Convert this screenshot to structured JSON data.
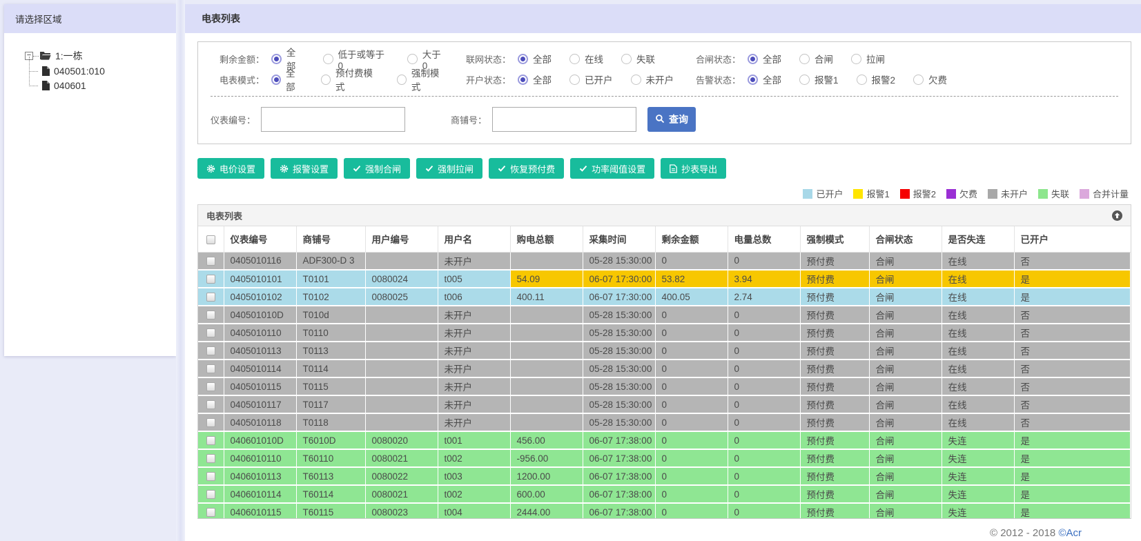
{
  "sidebar": {
    "title": "请选择区域",
    "tree": {
      "root_label": "1:一栋",
      "expander": "−",
      "children": [
        "040501:010",
        "040601"
      ]
    }
  },
  "main": {
    "title": "电表列表",
    "filters": [
      {
        "label": "剩余金额：",
        "options": [
          "全部",
          "低于或等于0",
          "大于0"
        ],
        "selected": 0
      },
      {
        "label": "联网状态：",
        "options": [
          "全部",
          "在线",
          "失联"
        ],
        "selected": 0
      },
      {
        "label": "合闸状态：",
        "options": [
          "全部",
          "合闸",
          "拉闸"
        ],
        "selected": 0
      },
      {
        "label": "电表模式：",
        "options": [
          "全部",
          "预付费模式",
          "强制模式"
        ],
        "selected": 0
      },
      {
        "label": "开户状态：",
        "options": [
          "全部",
          "已开户",
          "未开户"
        ],
        "selected": 0
      },
      {
        "label": "告警状态：",
        "options": [
          "全部",
          "报警1",
          "报警2",
          "欠费"
        ],
        "selected": 0
      }
    ],
    "search": {
      "meter_label": "仪表编号：",
      "meter_value": "",
      "meter_placeholder": "",
      "shop_label": "商铺号：",
      "shop_value": "",
      "shop_placeholder": "",
      "query_label": "查询",
      "query_icon": "search-icon",
      "query_color": "#4a74c4"
    },
    "actions": [
      {
        "label": "电价设置",
        "icon": "gear-icon"
      },
      {
        "label": "报警设置",
        "icon": "gear-icon"
      },
      {
        "label": "强制合闸",
        "icon": "check-icon"
      },
      {
        "label": "强制拉闸",
        "icon": "check-icon"
      },
      {
        "label": "恢复预付费",
        "icon": "check-icon"
      },
      {
        "label": "功率阈值设置",
        "icon": "check-icon"
      },
      {
        "label": "抄表导出",
        "icon": "file-export-icon"
      }
    ],
    "actions_color": "#18bc9c",
    "legend": [
      {
        "label": "已开户",
        "color": "#a8d8e8"
      },
      {
        "label": "报警1",
        "color": "#ffe500"
      },
      {
        "label": "报警2",
        "color": "#f50000"
      },
      {
        "label": "欠费",
        "color": "#9a2fd4"
      },
      {
        "label": "未开户",
        "color": "#a8a8a8"
      },
      {
        "label": "失联",
        "color": "#8de68d"
      },
      {
        "label": "合并计量",
        "color": "#dba8dc"
      }
    ],
    "table": {
      "panel_title": "电表列表",
      "collapse_icon": "arrow-up-circle-icon",
      "columns": [
        "仪表编号",
        "商铺号",
        "用户编号",
        "用户名",
        "购电总额",
        "采集时间",
        "剩余金额",
        "电量总数",
        "强制模式",
        "合闸状态",
        "是否失连",
        "已开户"
      ],
      "row_colors": {
        "gray": "#b5b5b5",
        "blue": "#abdbe9",
        "green": "#8fe693",
        "alert1": "#f7c700"
      },
      "rows": [
        {
          "variant": "gray",
          "alert_from": null,
          "cells": [
            "0405010116",
            "ADF300-D 3",
            "",
            "未开户",
            "",
            "05-28 15:30:00",
            "0",
            "0",
            "预付费",
            "合闸",
            "在线",
            "否"
          ]
        },
        {
          "variant": "blue",
          "alert_from": 4,
          "cells": [
            "0405010101",
            "T0101",
            "0080024",
            "t005",
            "54.09",
            "06-07 17:30:00",
            "53.82",
            "3.94",
            "预付费",
            "合闸",
            "在线",
            "是"
          ]
        },
        {
          "variant": "blue",
          "alert_from": null,
          "cells": [
            "0405010102",
            "T0102",
            "0080025",
            "t006",
            "400.11",
            "06-07 17:30:00",
            "400.05",
            "2.74",
            "预付费",
            "合闸",
            "在线",
            "是"
          ]
        },
        {
          "variant": "gray",
          "alert_from": null,
          "cells": [
            "040501010D",
            "T010d",
            "",
            "未开户",
            "",
            "05-28 15:30:00",
            "0",
            "0",
            "预付费",
            "合闸",
            "在线",
            "否"
          ]
        },
        {
          "variant": "gray",
          "alert_from": null,
          "cells": [
            "0405010110",
            "T0110",
            "",
            "未开户",
            "",
            "05-28 15:30:00",
            "0",
            "0",
            "预付费",
            "合闸",
            "在线",
            "否"
          ]
        },
        {
          "variant": "gray",
          "alert_from": null,
          "cells": [
            "0405010113",
            "T0113",
            "",
            "未开户",
            "",
            "05-28 15:30:00",
            "0",
            "0",
            "预付费",
            "合闸",
            "在线",
            "否"
          ]
        },
        {
          "variant": "gray",
          "alert_from": null,
          "cells": [
            "0405010114",
            "T0114",
            "",
            "未开户",
            "",
            "05-28 15:30:00",
            "0",
            "0",
            "预付费",
            "合闸",
            "在线",
            "否"
          ]
        },
        {
          "variant": "gray",
          "alert_from": null,
          "cells": [
            "0405010115",
            "T0115",
            "",
            "未开户",
            "",
            "05-28 15:30:00",
            "0",
            "0",
            "预付费",
            "合闸",
            "在线",
            "否"
          ]
        },
        {
          "variant": "gray",
          "alert_from": null,
          "cells": [
            "0405010117",
            "T0117",
            "",
            "未开户",
            "",
            "05-28 15:30:00",
            "0",
            "0",
            "预付费",
            "合闸",
            "在线",
            "否"
          ]
        },
        {
          "variant": "gray",
          "alert_from": null,
          "cells": [
            "0405010118",
            "T0118",
            "",
            "未开户",
            "",
            "05-28 15:30:00",
            "0",
            "0",
            "预付费",
            "合闸",
            "在线",
            "否"
          ]
        },
        {
          "variant": "green",
          "alert_from": null,
          "cells": [
            "040601010D",
            "T6010D",
            "0080020",
            "t001",
            "456.00",
            "06-07 17:38:00",
            "0",
            "0",
            "预付费",
            "合闸",
            "失连",
            "是"
          ]
        },
        {
          "variant": "green",
          "alert_from": null,
          "cells": [
            "0406010110",
            "T60110",
            "0080021",
            "t002",
            "-956.00",
            "06-07 17:38:00",
            "0",
            "0",
            "预付费",
            "合闸",
            "失连",
            "是"
          ]
        },
        {
          "variant": "green",
          "alert_from": null,
          "cells": [
            "0406010113",
            "T60113",
            "0080022",
            "t003",
            "1200.00",
            "06-07 17:38:00",
            "0",
            "0",
            "预付费",
            "合闸",
            "失连",
            "是"
          ]
        },
        {
          "variant": "green",
          "alert_from": null,
          "cells": [
            "0406010114",
            "T60114",
            "0080021",
            "t002",
            "600.00",
            "06-07 17:38:00",
            "0",
            "0",
            "预付费",
            "合闸",
            "失连",
            "是"
          ]
        },
        {
          "variant": "green",
          "alert_from": null,
          "cells": [
            "0406010115",
            "T60115",
            "0080023",
            "t004",
            "2444.00",
            "06-07 17:38:00",
            "0",
            "0",
            "预付费",
            "合闸",
            "失连",
            "是"
          ]
        }
      ]
    },
    "footer": {
      "text": "© 2012 - 2018 ",
      "link": "©Acr"
    }
  }
}
